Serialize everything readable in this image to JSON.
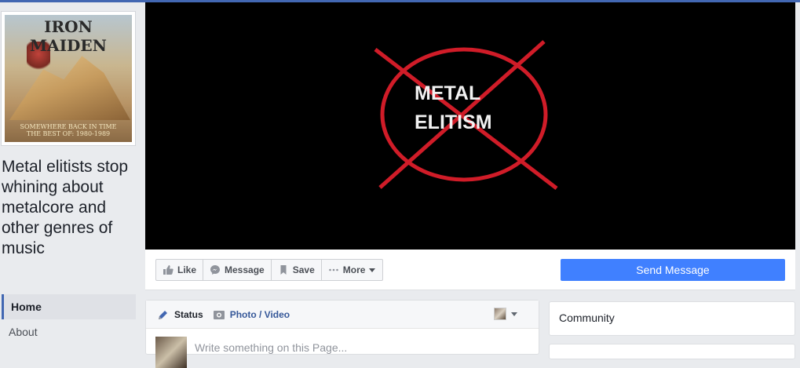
{
  "page": {
    "name": "Metal elitists stop whining about metalcore and other genres of music"
  },
  "profile_picture": {
    "logo_text": "IRON MAIDEN",
    "caption_line1": "SOMEWHERE BACK IN TIME",
    "caption_line2": "THE BEST OF: 1980-1989"
  },
  "cover": {
    "text_line1": "METAL",
    "text_line2": "ELITISM",
    "cross_color": "#d01c28"
  },
  "nav": {
    "home": "Home",
    "about": "About"
  },
  "actions": {
    "like": "Like",
    "message": "Message",
    "save": "Save",
    "more": "More",
    "send_message": "Send Message"
  },
  "composer": {
    "status_tab": "Status",
    "photo_tab": "Photo / Video",
    "placeholder": "Write something on this Page..."
  },
  "sidebar_right": {
    "community_title": "Community"
  },
  "colors": {
    "brand_blue": "#4267b2",
    "button_blue": "#4080ff",
    "link_blue": "#365899",
    "background": "#e9ebee"
  }
}
